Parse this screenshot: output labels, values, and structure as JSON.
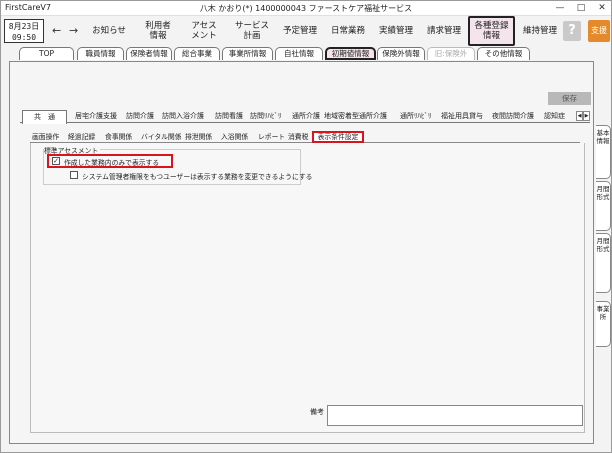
{
  "window": {
    "app_name": "FirstCareV7",
    "title": "八木 かおり(*) 1400000043 ファーストケア福祉サービス",
    "minimize": "—",
    "maximize": "□",
    "close": "✕"
  },
  "date": {
    "line1": "8月23日",
    "line2": "09:50"
  },
  "nav": {
    "back_icon": "←",
    "forward_icon": "→",
    "items": [
      {
        "label": "お知らせ"
      },
      {
        "label": "利用者\n情報"
      },
      {
        "label": "アセス\nメント"
      },
      {
        "label": "サービス\n計画"
      },
      {
        "label": "予定管理"
      },
      {
        "label": "日常業務"
      },
      {
        "label": "実績管理"
      },
      {
        "label": "請求管理"
      },
      {
        "label": "各種登録\n情報"
      },
      {
        "label": "維持管理"
      }
    ],
    "help": "?",
    "support": "支援"
  },
  "tabs_level1": [
    {
      "label": "TOP"
    },
    {
      "label": "職員情報"
    },
    {
      "label": "保険者情報"
    },
    {
      "label": "総合事業"
    },
    {
      "label": "事業所情報"
    },
    {
      "label": "自社情報"
    },
    {
      "label": "初期値情報"
    },
    {
      "label": "保険外情報"
    },
    {
      "label": "旧:保険外"
    },
    {
      "label": "その他情報"
    }
  ],
  "save_label": "保存",
  "tabs_level2": [
    {
      "label": "共　通"
    },
    {
      "label": "居宅介護支援"
    },
    {
      "label": "訪問介護"
    },
    {
      "label": "訪問入浴介護"
    },
    {
      "label": "訪問看護"
    },
    {
      "label": "訪問ﾘﾊﾋﾞﾘ"
    },
    {
      "label": "通所介護"
    },
    {
      "label": "地域密着型通所介護"
    },
    {
      "label": "通所ﾘﾊﾋﾞﾘ"
    },
    {
      "label": "福祉用具貸与"
    },
    {
      "label": "夜間訪問介護"
    },
    {
      "label": "認知症"
    }
  ],
  "scroll_left": "◀",
  "scroll_right": "▶",
  "tabs_level3": [
    {
      "label": "画面操作"
    },
    {
      "label": "経過記録"
    },
    {
      "label": "食事関係"
    },
    {
      "label": "バイタル関係"
    },
    {
      "label": "排泄関係"
    },
    {
      "label": "入浴関係"
    },
    {
      "label": "レポート"
    },
    {
      "label": "消費税"
    },
    {
      "label": "表示条件設定"
    }
  ],
  "settings": {
    "group_label": "標準アセスメント",
    "option1": {
      "label": "作成した業務内のみで表示する",
      "checked": true,
      "mark": "✓"
    },
    "option2": {
      "label": "システム管理者権限をもつユーザーは表示する業務を変更できるようにする",
      "checked": false,
      "mark": ""
    }
  },
  "note": {
    "label": "備考",
    "value": ""
  },
  "side_tabs": [
    {
      "label": "基本情報"
    },
    {
      "label": "月間形式"
    },
    {
      "label": "月間形式"
    },
    {
      "label": "事業所"
    }
  ]
}
